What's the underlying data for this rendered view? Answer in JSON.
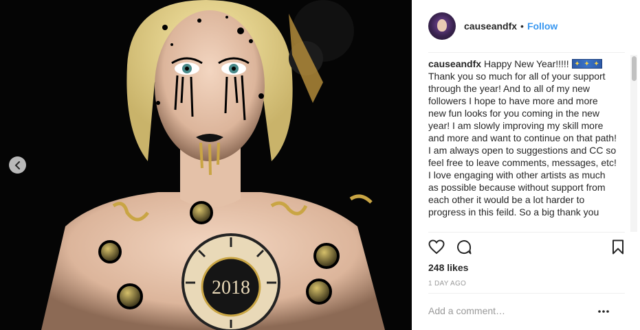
{
  "post": {
    "image_alt": "Woman with New Year clock body paint showing 2018",
    "clock_text": "2018"
  },
  "header": {
    "username": "causeandfx",
    "separator": "•",
    "follow_label": "Follow"
  },
  "caption": {
    "username": "causeandfx",
    "opening": "Happy New Year!!!!!",
    "body": "Thank you so much for all of your support through the year! And to all of my new followers I hope to have more and more new fun looks for you coming in the new year! I am slowly improving my skill more and more and want to continue on that path! I am always open to suggestions and CC so feel free to leave comments, messages, etc! I love engaging with other artists as much as possible because without support from each other it would be a lot harder to progress in this feild. So a big thank you"
  },
  "actions": {
    "like_icon": "heart-icon",
    "comment_icon": "comment-icon",
    "save_icon": "bookmark-icon"
  },
  "likes_text": "248 likes",
  "time_text": "1 DAY AGO",
  "comment": {
    "placeholder": "Add a comment…",
    "more_label": "•••"
  },
  "colors": {
    "link": "#3897f0",
    "text": "#262626",
    "muted": "#999999",
    "divider": "#efefef"
  }
}
